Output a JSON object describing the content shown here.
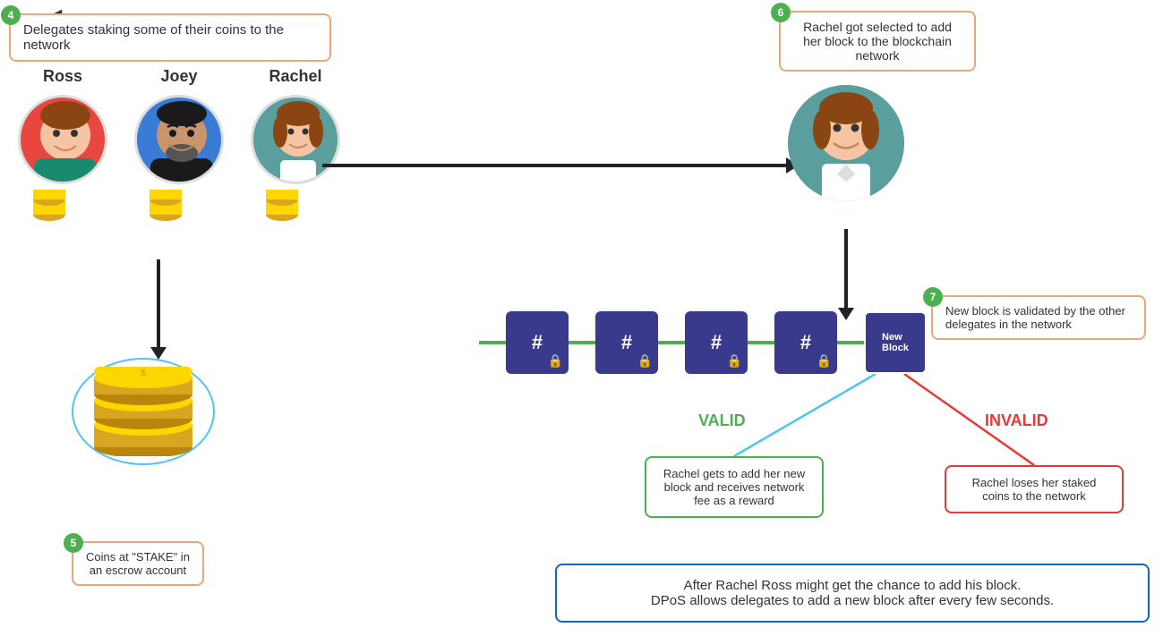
{
  "back_arrow": "◄",
  "step4": {
    "number": "4",
    "text": "Delegates staking some of their coins to the network"
  },
  "delegates": [
    {
      "name": "Ross",
      "avatar_color": "#e8473f"
    },
    {
      "name": "Joey",
      "avatar_color": "#3a7bd5"
    },
    {
      "name": "Rachel",
      "avatar_color": "#5b9e9e"
    }
  ],
  "step5": {
    "number": "5",
    "text": "Coins at \"STAKE\" in\nan escrow account"
  },
  "step6": {
    "number": "6",
    "text": "Rachel got selected to add her block to the blockchain network"
  },
  "step7": {
    "number": "7",
    "text": "New block is validated by the other delegates in the network"
  },
  "valid_label": "VALID",
  "invalid_label": "INVALID",
  "valid_box": {
    "text": "Rachel gets to add her new block and receives network fee as a reward"
  },
  "invalid_box": {
    "text": "Rachel loses her staked coins to the network"
  },
  "bottom_info": {
    "text": "After Rachel Ross might get the chance to add his block.\nDPoS allows delegates to add a new block after every few seconds."
  },
  "blocks": [
    {
      "symbol": "#",
      "locked": true
    },
    {
      "symbol": "#",
      "locked": true
    },
    {
      "symbol": "#",
      "locked": true
    },
    {
      "symbol": "#",
      "locked": true
    }
  ],
  "new_block_label": "New\nBlock"
}
